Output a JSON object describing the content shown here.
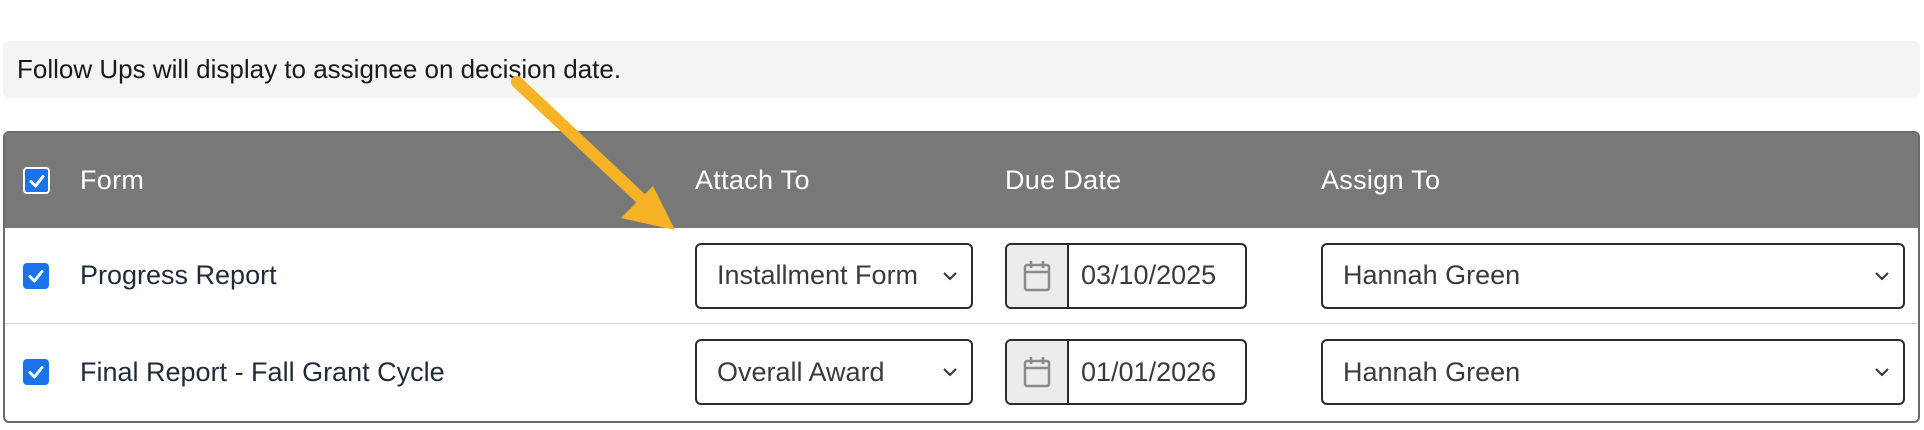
{
  "notice": "Follow Ups will display to assignee on decision date.",
  "header": {
    "form": "Form",
    "attach_to": "Attach To",
    "due_date": "Due Date",
    "assign_to": "Assign To"
  },
  "rows": [
    {
      "form": "Progress Report",
      "attach_to": "Installment Form",
      "due_date": "03/10/2025",
      "assign_to": "Hannah Green",
      "checked": true
    },
    {
      "form": "Final Report - Fall Grant Cycle",
      "attach_to": "Overall Award",
      "due_date": "01/01/2026",
      "assign_to": "Hannah Green",
      "checked": true
    }
  ],
  "colors": {
    "header_bg": "#787878",
    "checkbox": "#1a73e8",
    "annotation_arrow": "#f6b326"
  },
  "icons": {
    "checkbox": "check-icon",
    "dropdown": "chevron-down-icon",
    "date": "calendar-icon",
    "annotation": "arrow-annotation"
  }
}
